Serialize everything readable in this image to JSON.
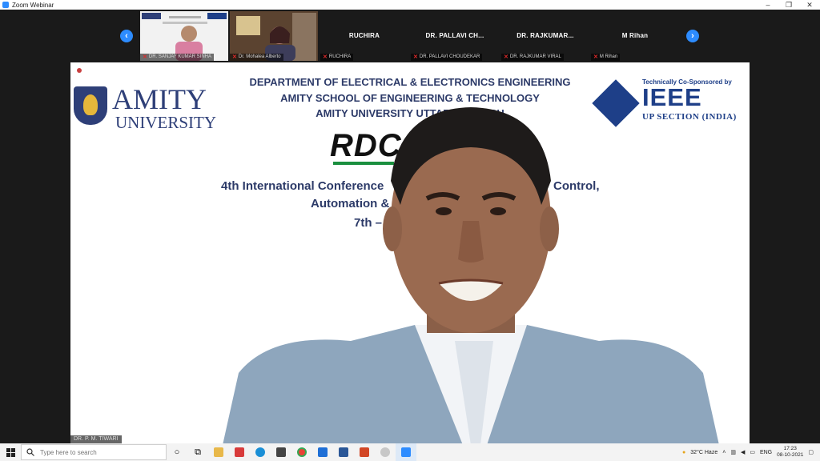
{
  "window": {
    "title": "Zoom Webinar",
    "minimize": "–",
    "restore": "❐",
    "close": "✕"
  },
  "participants": {
    "prev_arrow": "‹",
    "next_arrow": "›",
    "tiles": [
      {
        "name": "",
        "caption": "DR. SANJAY KUMAR SINHA",
        "muted": true
      },
      {
        "name": "",
        "caption": "Dr. Mohalea Alberto",
        "muted": true
      },
      {
        "name": "RUCHIRA",
        "caption": "RUCHIRA",
        "muted": true
      },
      {
        "name": "DR. PALLAVI CH...",
        "caption": "DR. PALLAVI CHOUDEKAR",
        "muted": true
      },
      {
        "name": "DR. RAJKUMAR...",
        "caption": "DR. RAJKUMAR VIRAL",
        "muted": true
      },
      {
        "name": "M Rihan",
        "caption": "M Rihan",
        "muted": true
      }
    ]
  },
  "slide": {
    "line1": "DEPARTMENT OF ELECTRICAL & ELECTRONICS ENGINEERING",
    "line2": "AMITY SCHOOL OF ENGINEERING & TECHNOLOGY",
    "line3": "AMITY UNIVERSITY UTTAR PRADESH",
    "amity_word": "AMITY",
    "amity_sub": "UNIVERSITY",
    "ieee_tag": "Technically Co-Sponsored by",
    "ieee_word": "IEEE",
    "ieee_sub": "UP SECTION (INDIA)",
    "rdc": "RDC",
    "conference_line1a": "4th International Conference",
    "conference_line1b": "Control,",
    "conference_line2": "Automation &",
    "conference_line3": "7th – 8"
  },
  "speaker": {
    "label": "DR. P. M. TIWARI"
  },
  "taskbar": {
    "search_placeholder": "Type here to search",
    "weather": "32°C Haze",
    "language": "ENG",
    "time": "17:23",
    "date": "08-10-2021"
  }
}
